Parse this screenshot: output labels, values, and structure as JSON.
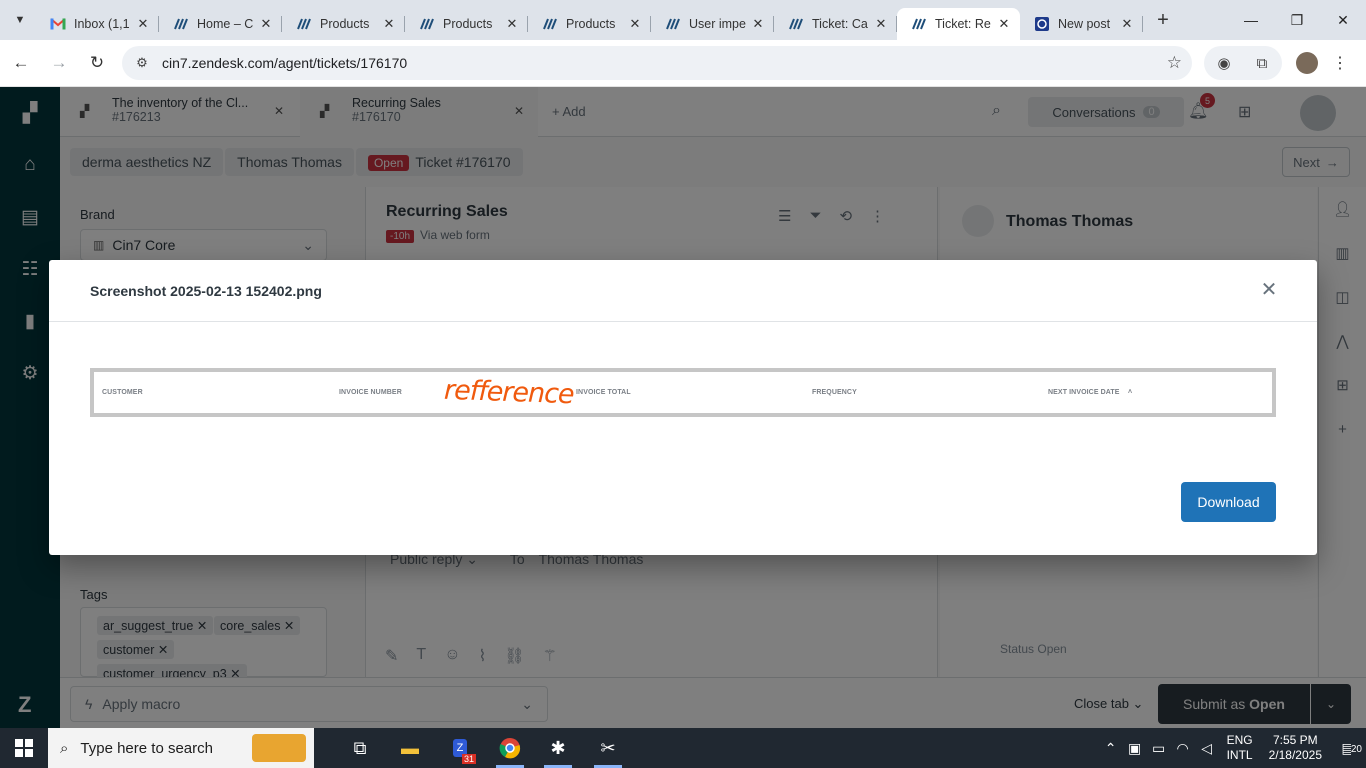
{
  "browser": {
    "tabs": [
      {
        "title": "Inbox (1,1",
        "icon": "gmail-icon"
      },
      {
        "title": "Home – C",
        "icon": "cin7-icon"
      },
      {
        "title": "Products",
        "icon": "cin7-icon"
      },
      {
        "title": "Products",
        "icon": "cin7-icon"
      },
      {
        "title": "Products",
        "icon": "cin7-icon"
      },
      {
        "title": "User impe",
        "icon": "cin7-icon"
      },
      {
        "title": "Ticket: Ca",
        "icon": "cin7-icon"
      },
      {
        "title": "Ticket: Re",
        "icon": "cin7-icon",
        "active": true
      },
      {
        "title": "New post",
        "icon": "wordpress-icon"
      }
    ],
    "url": "cin7.zendesk.com/agent/tickets/176170"
  },
  "app": {
    "ticket_tabs": [
      {
        "title": "The inventory of the Cl...",
        "id": "#176213"
      },
      {
        "title": "Recurring Sales",
        "id": "#176170"
      }
    ],
    "add_label": "Add",
    "conversations_label": "Conversations",
    "conversations_count": "0",
    "notifications_count": "5",
    "breadcrumb": {
      "org": "derma aesthetics NZ",
      "requester": "Thomas Thomas",
      "status": "Open",
      "ticket": "Ticket #176170"
    },
    "next_label": "Next",
    "brand_label": "Brand",
    "brand_value": "Cin7 Core",
    "tags_label": "Tags",
    "tags": [
      "ar_suggest_true",
      "core_sales",
      "customer",
      "customer_urgency_p3"
    ],
    "ticket_title": "Recurring Sales",
    "ticket_age": "-10h",
    "ticket_channel": "Via web form",
    "reply_type": "Public reply",
    "to_label": "To",
    "to_name": "Thomas Thomas",
    "requester_name": "Thomas Thomas",
    "status_line": "Status Open",
    "macro_label": "Apply macro",
    "close_tab_label": "Close tab",
    "submit_prefix": "Submit as",
    "submit_status": "Open"
  },
  "modal": {
    "title": "Screenshot 2025-02-13 152402.png",
    "columns": [
      "CUSTOMER",
      "INVOICE NUMBER",
      "INVOICE TOTAL",
      "FREQUENCY",
      "NEXT INVOICE DATE"
    ],
    "annotation": "refference",
    "download_label": "Download"
  },
  "taskbar": {
    "search_placeholder": "Type here to search",
    "lang_top": "ENG",
    "lang_bottom": "INTL",
    "time": "7:55 PM",
    "date": "2/18/2025",
    "notification_count": "20",
    "calendar_badge": "31"
  }
}
